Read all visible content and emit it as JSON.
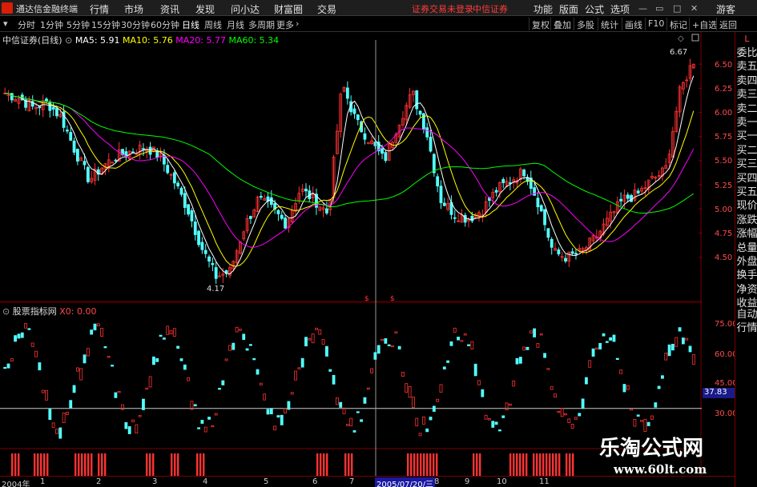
{
  "menubar": {
    "app_name": "通达信金融终端",
    "items": [
      "行情",
      "市场",
      "资讯",
      "发现",
      "问小达",
      "财富圈",
      "交易"
    ],
    "notice": "证券交易未登录",
    "broker": "中信证券",
    "right_items": [
      "功能",
      "版面",
      "公式",
      "选项"
    ],
    "user": "游客"
  },
  "toolbar": {
    "periods": [
      "分时",
      "1分钟",
      "5分钟",
      "15分钟",
      "30分钟",
      "60分钟",
      "日线",
      "周线",
      "月线",
      "多周期",
      "更多"
    ],
    "active_period": "日线",
    "right_tools": [
      "复权",
      "叠加",
      "多股",
      "统计",
      "画线",
      "F10",
      "标记",
      "+自选",
      "返回"
    ]
  },
  "stock": {
    "name": "中信证券(日线)",
    "ma5_label": "MA5: 5.91",
    "ma10_label": "MA10: 5.76",
    "ma20_label": "MA20: 5.77",
    "ma60_label": "MA60: 5.34",
    "high_label": "6.67",
    "low_label": "4.17"
  },
  "indicator": {
    "name": "股票指标网",
    "value_label": "X0: 0.00",
    "current_value": "37.83"
  },
  "price_axis": [
    "6.50",
    "6.25",
    "6.00",
    "5.75",
    "5.50",
    "5.25",
    "5.00",
    "4.75",
    "4.50"
  ],
  "ind_axis": [
    "75.00",
    "60.00",
    "45.00",
    "30.00"
  ],
  "date_axis": {
    "labels": [
      "2004年",
      "1",
      "2",
      "3",
      "4",
      "5",
      "6",
      "7",
      "8",
      "9",
      "10",
      "11"
    ],
    "cursor_date": "2005/07/20/三"
  },
  "side_panel": {
    "top": "L",
    "items": [
      "委比",
      "卖五",
      "卖四",
      "卖三",
      "卖二",
      "卖一",
      "买一",
      "买二",
      "买三",
      "买四",
      "买五",
      "现价",
      "涨跌",
      "涨幅",
      "总量",
      "外盘",
      "换手",
      "净资",
      "收益"
    ],
    "bottom": [
      "自动",
      "行情"
    ]
  },
  "watermark": {
    "title": "乐淘公式网",
    "url": "www.60lt.com"
  },
  "colors": {
    "up": "#ff3232",
    "down": "#54ffff",
    "ma5": "#ffffff",
    "ma10": "#ffff00",
    "ma20": "#ff00ff",
    "ma60": "#00ff00",
    "axis": "#7a0000"
  },
  "chart_data": {
    "type": "candlestick",
    "title": "中信证券(日线)",
    "ylim": [
      4.1,
      6.75
    ],
    "high": 6.67,
    "low": 4.17,
    "ma_values": {
      "MA5": 5.91,
      "MA10": 5.76,
      "MA20": 5.77,
      "MA60": 5.34
    },
    "close_trend": [
      6.2,
      6.15,
      6.05,
      6.1,
      5.95,
      5.6,
      5.3,
      5.45,
      5.55,
      5.6,
      5.65,
      5.55,
      5.3,
      5.0,
      4.6,
      4.3,
      4.35,
      4.8,
      5.1,
      5.0,
      4.85,
      5.2,
      5.1,
      4.95,
      6.3,
      5.9,
      5.7,
      5.5,
      5.9,
      6.2,
      5.8,
      5.1,
      4.95,
      4.9,
      5.0,
      5.2,
      5.3,
      5.4,
      5.05,
      4.55,
      4.5,
      4.55,
      4.7,
      4.9,
      5.1,
      5.15,
      5.3,
      5.4,
      6.2,
      6.55
    ]
  }
}
